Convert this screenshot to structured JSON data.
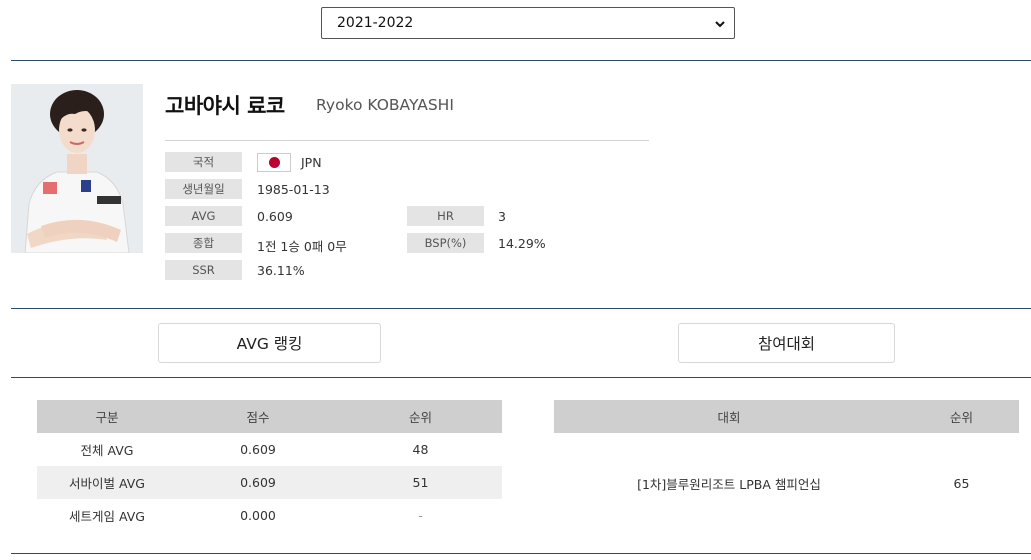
{
  "season_select": {
    "value": "2021-2022"
  },
  "player": {
    "name_ko": "고바야시 료코",
    "name_en": "Ryoko KOBAYASHI",
    "fields": {
      "nationality_label": "국적",
      "nationality_value": "JPN",
      "birthdate_label": "생년월일",
      "birthdate_value": "1985-01-13",
      "avg_label": "AVG",
      "avg_value": "0.609",
      "hr_label": "HR",
      "hr_value": "3",
      "record_label": "종합",
      "record_value": "1전 1승 0패 0무",
      "bsp_label": "BSP(%)",
      "bsp_value": "14.29%",
      "ssr_label": "SSR",
      "ssr_value": "36.11%"
    }
  },
  "tabs": {
    "avg_ranking": "AVG 랭킹",
    "tournaments": "참여대회"
  },
  "avg_table": {
    "headers": [
      "구분",
      "점수",
      "순위"
    ],
    "rows": [
      [
        "전체 AVG",
        "0.609",
        "48"
      ],
      [
        "서바이벌 AVG",
        "0.609",
        "51"
      ],
      [
        "세트게임 AVG",
        "0.000",
        "-"
      ]
    ]
  },
  "tournament_table": {
    "headers": [
      "대회",
      "순위"
    ],
    "rows": [
      [
        "[1차]블루원리조트 LPBA 챔피언십",
        "65"
      ]
    ]
  },
  "colors": {
    "divider": "#2c4a63",
    "label_bg": "#e4e4e4",
    "table_header_bg": "#cfcfcf",
    "row_shade": "#efefef",
    "flag_red": "#bc002d"
  },
  "icons": {
    "select_arrow": "chevron-down-icon",
    "flag": "japan-flag-icon"
  }
}
